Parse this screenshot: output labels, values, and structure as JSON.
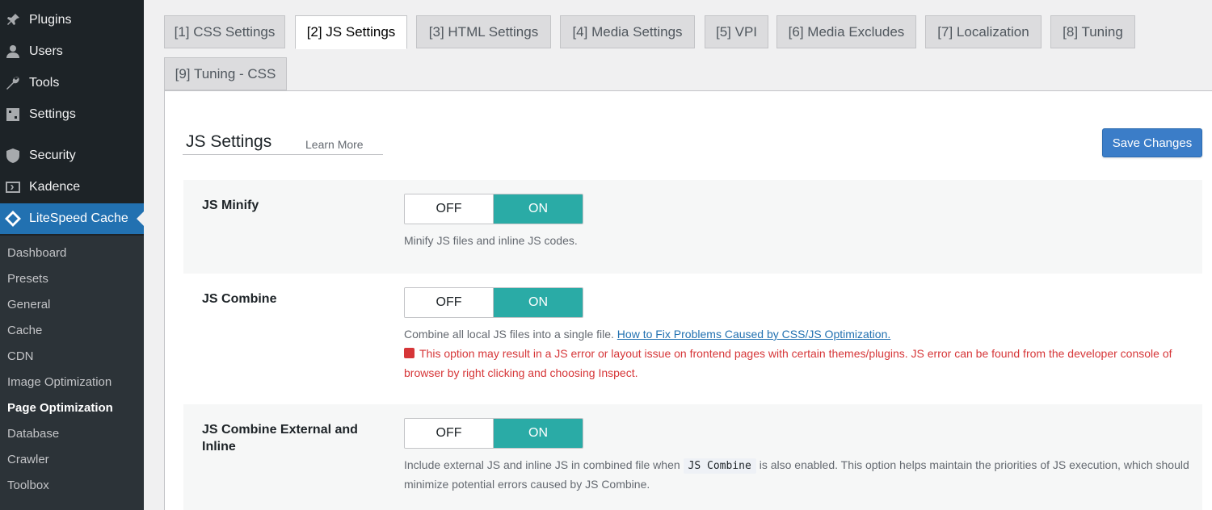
{
  "sidebar": {
    "menu": [
      {
        "label": "Plugins",
        "icon": "plugin-icon"
      },
      {
        "label": "Users",
        "icon": "user-icon"
      },
      {
        "label": "Tools",
        "icon": "wrench-icon"
      },
      {
        "label": "Settings",
        "icon": "settings-icon"
      },
      {
        "label": "Security",
        "icon": "shield-icon"
      },
      {
        "label": "Kadence",
        "icon": "kadence-icon"
      },
      {
        "label": "LiteSpeed Cache",
        "icon": "litespeed-icon"
      }
    ],
    "submenu": [
      "Dashboard",
      "Presets",
      "General",
      "Cache",
      "CDN",
      "Image Optimization",
      "Page Optimization",
      "Database",
      "Crawler",
      "Toolbox"
    ],
    "current_submenu": "Page Optimization"
  },
  "tabs": [
    "[1] CSS Settings",
    "[2] JS Settings",
    "[3] HTML Settings",
    "[4] Media Settings",
    "[5] VPI",
    "[6] Media Excludes",
    "[7] Localization",
    "[8] Tuning",
    "[9] Tuning - CSS"
  ],
  "active_tab": "[2] JS Settings",
  "section": {
    "title": "JS Settings",
    "learn_more": "Learn More",
    "save_label": "Save Changes"
  },
  "settings": [
    {
      "label": "JS Minify",
      "off_label": "OFF",
      "on_label": "ON",
      "value": "ON",
      "description": "Minify JS files and inline JS codes."
    },
    {
      "label": "JS Combine",
      "off_label": "OFF",
      "on_label": "ON",
      "value": "ON",
      "description": "Combine all local JS files into a single file.",
      "link": "How to Fix Problems Caused by CSS/JS Optimization.",
      "warning": "This option may result in a JS error or layout issue on frontend pages with certain themes/plugins. JS error can be found from the developer console of browser by right clicking and choosing Inspect."
    },
    {
      "label": "JS Combine External and Inline",
      "off_label": "OFF",
      "on_label": "ON",
      "value": "ON",
      "description_pre": "Include external JS and inline JS in combined file when",
      "description_code": "JS Combine",
      "description_post": "is also enabled. This option helps maintain the priorities of JS execution, which should minimize potential errors caused by JS Combine."
    }
  ],
  "colors": {
    "sidebar_bg": "#1d2327",
    "active_menu": "#2271b1",
    "toggle_on": "#2aaba6",
    "warning": "#d63638",
    "save_button": "#3b7dc8"
  }
}
